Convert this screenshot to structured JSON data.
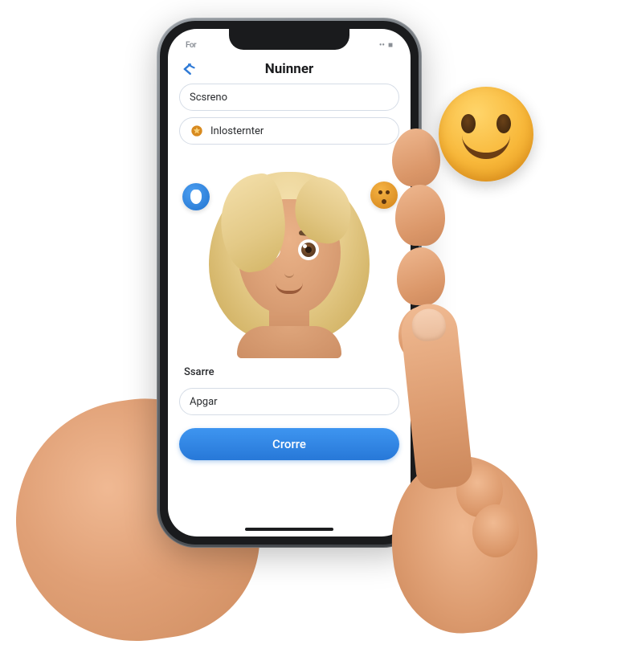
{
  "status": {
    "time_label": "For",
    "signal": "••",
    "battery": "■"
  },
  "header": {
    "title": "Nuinner",
    "back_icon": "back"
  },
  "fields": {
    "first": {
      "value": "Scsreno"
    },
    "second": {
      "value": "Inlosternter",
      "icon": "star-icon"
    }
  },
  "avatar": {
    "pin_icon": "pin-icon",
    "react_icon": "surprise-icon",
    "description": "blonde-woman-avatar"
  },
  "section": {
    "label": "Ssarre"
  },
  "input": {
    "value": "Apgar"
  },
  "cta": {
    "label": "Crorre"
  },
  "external": {
    "smiley": "smile-emoji"
  },
  "colors": {
    "accent": "#2a7cd6",
    "border": "#d5dce6",
    "skin": "#e0a076",
    "hair": "#e3c986",
    "smiley": "#f8b83a"
  }
}
